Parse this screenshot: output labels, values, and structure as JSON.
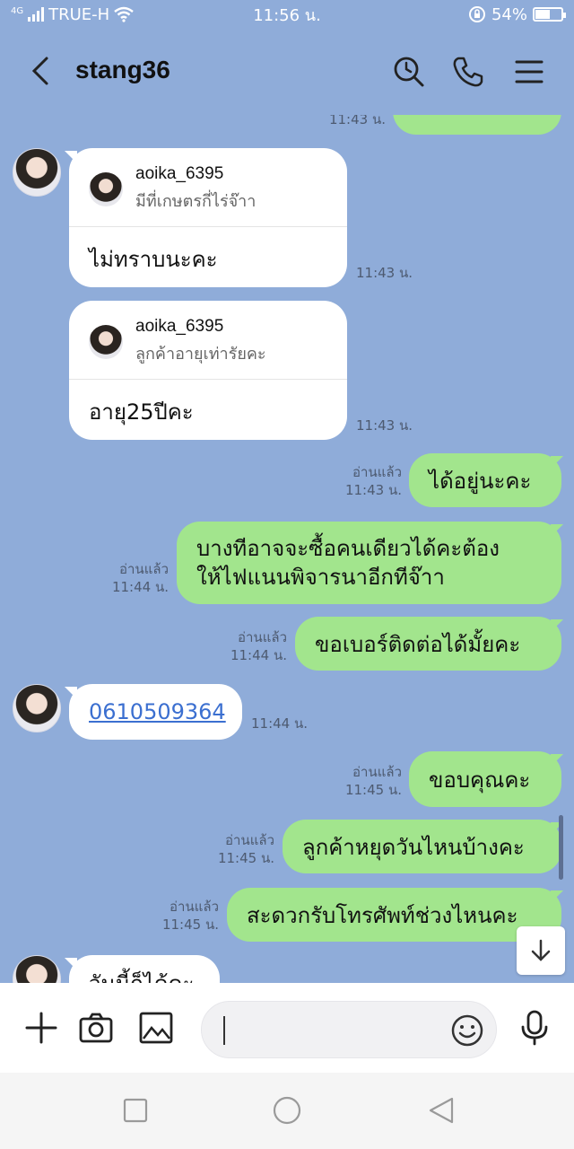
{
  "status": {
    "carrier": "TRUE-H",
    "network": "4G",
    "time": "11:56 น.",
    "battery": "54%",
    "battery_level": 0.54
  },
  "header": {
    "contact_name": "stang36"
  },
  "messages": [
    {
      "type": "partial",
      "time": "11:43 น."
    },
    {
      "type": "reply-in",
      "reply_to_user": "aoika_6395",
      "quoted_text": "มีที่เกษตรกี่ไร่จ๊าา",
      "text": "ไม่ทราบนะคะ",
      "time": "11:43 น."
    },
    {
      "type": "reply-in",
      "reply_to_user": "aoika_6395",
      "quoted_text": "ลูกค้าอายุเท่ารัยคะ",
      "text": "อายุ25ปีคะ",
      "time": "11:43 น."
    },
    {
      "type": "out",
      "read_label": "อ่านแล้ว",
      "time": "11:43 น.",
      "text": "ได้อยู่นะคะ"
    },
    {
      "type": "out",
      "read_label": "อ่านแล้ว",
      "time": "11:44 น.",
      "text_line1": "บางทีอาจจะซื้อคนเดียวได้คะต้อง",
      "text_line2": "ให้ไฟแนนพิจารนาอีกทีจ๊าา"
    },
    {
      "type": "out",
      "read_label": "อ่านแล้ว",
      "time": "11:44 น.",
      "text": "ขอเบอร์ติดต่อได้มั้ยคะ"
    },
    {
      "type": "in",
      "text": "0610509364",
      "time": "11:44 น."
    },
    {
      "type": "out",
      "read_label": "อ่านแล้ว",
      "time": "11:45 น.",
      "text": "ขอบคุณคะ"
    },
    {
      "type": "out",
      "read_label": "อ่านแล้ว",
      "time": "11:45 น.",
      "text": "ลูกค้าหยุดวันไหนบ้างคะ"
    },
    {
      "type": "out",
      "read_label": "อ่านแล้ว",
      "time": "11:45 น.",
      "text": "สะดวกรับโทรศัพท์ช่วงไหนคะ"
    },
    {
      "type": "in-partial",
      "text": "วันนี้ก็ได้คะ"
    }
  ],
  "input": {
    "placeholder": ""
  },
  "colors": {
    "chat_bg": "#8facd9",
    "out_bubble": "#a2e58d",
    "in_bubble": "#ffffff",
    "link": "#3b6fd0"
  },
  "icons": [
    "back-icon",
    "search-history-icon",
    "phone-icon",
    "menu-icon",
    "plus-icon",
    "camera-icon",
    "image-icon",
    "emoji-icon",
    "mic-icon",
    "scroll-down-icon"
  ]
}
